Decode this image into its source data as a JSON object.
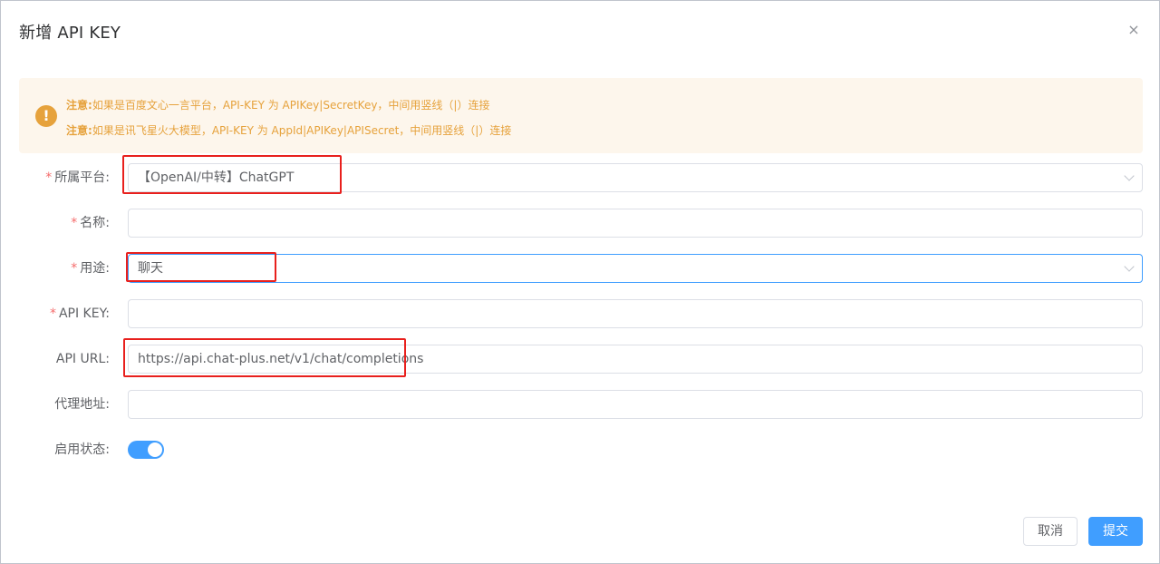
{
  "dialog": {
    "title": "新增 API KEY",
    "close_icon": "×"
  },
  "alert": {
    "icon": "!",
    "lines": [
      {
        "prefix": "注意:",
        "text": "如果是百度文心一言平台，API-KEY 为 APIKey|SecretKey，中间用竖线（|）连接"
      },
      {
        "prefix": "注意:",
        "text": "如果是讯飞星火大模型，API-KEY 为 AppId|APIKey|APISecret，中间用竖线（|）连接"
      }
    ]
  },
  "form": {
    "platform": {
      "required": "*",
      "label": "所属平台:",
      "value": "【OpenAI/中转】ChatGPT"
    },
    "name": {
      "required": "*",
      "label": "名称:",
      "value": ""
    },
    "usage": {
      "required": "*",
      "label": "用途:",
      "value": "聊天"
    },
    "api_key": {
      "required": "*",
      "label": "API KEY:",
      "value": ""
    },
    "api_url": {
      "label": "API URL:",
      "value": "https://api.chat-plus.net/v1/chat/completions"
    },
    "proxy": {
      "label": "代理地址:",
      "value": ""
    },
    "enabled": {
      "label": "启用状态:",
      "value": true
    }
  },
  "footer": {
    "cancel_label": "取消",
    "submit_label": "提交"
  },
  "colors": {
    "primary": "#409eff",
    "warning": "#e6a23c",
    "required": "#f56c6c",
    "annotation": "#e8201d"
  }
}
